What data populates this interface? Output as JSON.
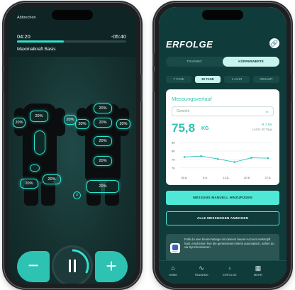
{
  "left_screen": {
    "abort_label": "Abbrechen",
    "time_elapsed": "04:20",
    "time_remaining": "-05:40",
    "progress": 0.43,
    "program_name": "Maximalkraft Basis",
    "pads": {
      "chest_left": "20%",
      "chest_right": "20%",
      "arm_left": "20%",
      "arm_mid": "20%",
      "shoulder_back": "20%",
      "arm_back_left": "20%",
      "arm_back_right": "20%",
      "back_upper": "20%",
      "back_lower": "20%",
      "glute": "20%",
      "leg_front_left": "20%",
      "leg_front_right": "20%",
      "leg_back": "20%"
    },
    "minus_glyph": "−",
    "plus_glyph": "+",
    "close_glyph": "×",
    "accent": "#2ee3cf"
  },
  "right_screen": {
    "title": "ERFOLGE",
    "link_icon_glyph": "🔗",
    "main_tabs": [
      "TRAINING",
      "KÖRPERWERTE"
    ],
    "period_tabs": [
      "7 TAGE",
      "30 TAGE",
      "1 JAHR",
      "GESAMT"
    ],
    "card": {
      "title": "Messungsverlauf",
      "select_value": "Gewicht",
      "value": "75,8",
      "unit": "KG",
      "delta": "▼ 2,5%",
      "delta_sub": "Letzte 30 Tage"
    },
    "primary_button": "MESSUNG MANUELL HINZUFÜGEN",
    "secondary_button": "ALLE MESSUNGEN ANZEIGEN",
    "info_text": "Falls du eine beurer-Waage mit deinem beurer-Account verknüpft hast, erscheinen hier die gemessenen Werte automatisch, sofern du via Synchronisieren",
    "info_icon_caption": "beurer",
    "tabs": [
      {
        "label": "HOME",
        "icon": "⌂"
      },
      {
        "label": "TRAINING",
        "icon": "∿"
      },
      {
        "label": "ERFOLGE",
        "icon": "♁"
      },
      {
        "label": "MEHR",
        "icon": "▦"
      }
    ],
    "accent": "#4fe8d6",
    "brand": "#0f3b3a"
  },
  "chart_data": {
    "type": "line",
    "x": [
      "30.6.",
      "6.8.",
      "13.8.",
      "20.8.",
      "27.8."
    ],
    "series": [
      {
        "values": [
          76.5,
          77,
          75.3,
          73.5,
          76,
          75.8
        ]
      }
    ],
    "y_ticks": [
      "85",
      "80",
      "75",
      "70"
    ],
    "ylim": [
      67,
      88
    ],
    "grid": true
  }
}
